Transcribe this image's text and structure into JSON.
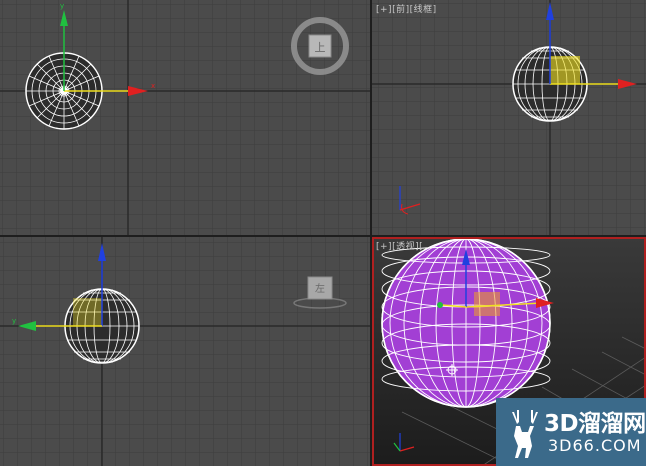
{
  "viewports": {
    "top_right": {
      "label_parts": [
        "[+]",
        "[前]",
        "[线框]"
      ]
    },
    "perspective": {
      "label_parts": [
        "[+]",
        "[透视]",
        "["
      ]
    }
  },
  "viewcube": {
    "top": "上",
    "left": "左"
  },
  "watermark": {
    "brand": "3D溜溜网",
    "url": "3D66.COM"
  },
  "colors": {
    "grid_bg": "#4b4b4b",
    "grid_line": "#3c3c3c",
    "grid_major": "#2e2e2e",
    "wire": "#ffffff",
    "sphere_fill": "#a23fd4",
    "axis_x": "#e02020",
    "axis_y": "#20c040",
    "axis_z": "#2040e0",
    "gizmo_yellow": "#f0e020",
    "active_border": "#b02020",
    "watermark_bg": "#3b6a8a"
  }
}
